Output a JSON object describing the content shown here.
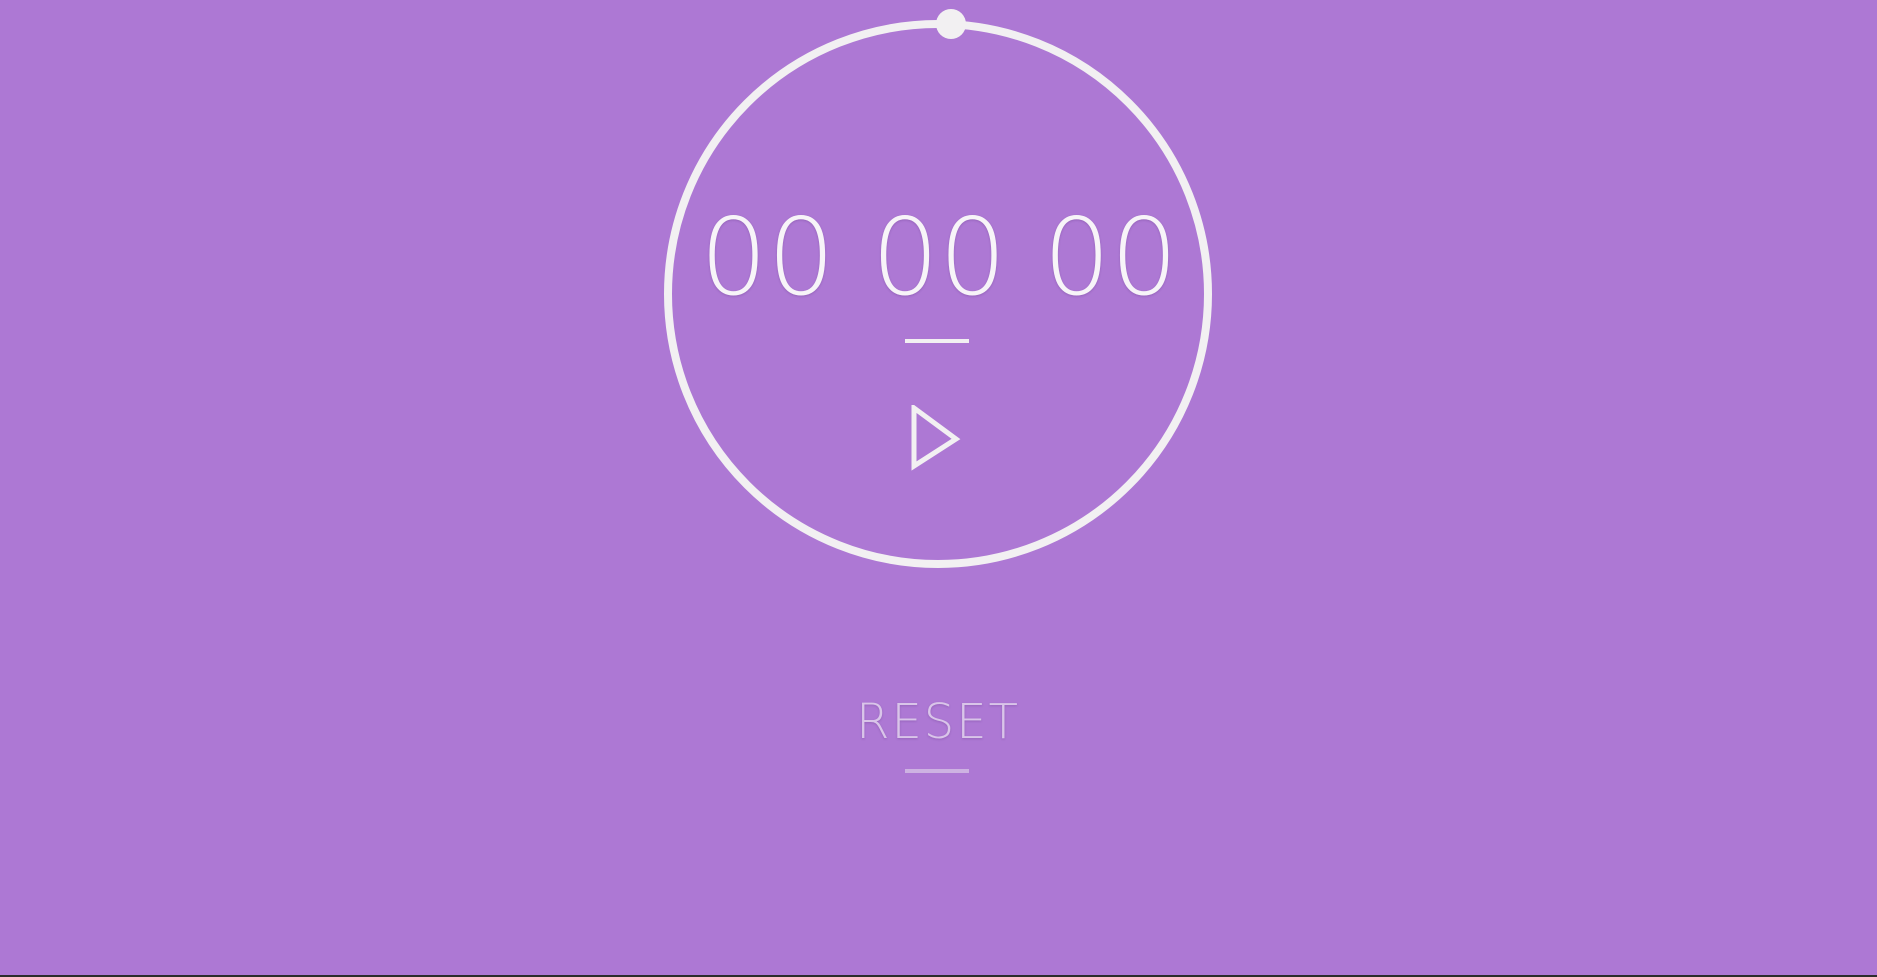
{
  "timer": {
    "hours": "00",
    "minutes": "00",
    "seconds": "00"
  },
  "controls": {
    "play_icon": "play-icon",
    "reset_label": "RESET"
  },
  "theme": {
    "background": "#ad78d4",
    "foreground": "#f2f0f2",
    "muted": "#d9c5e9"
  }
}
